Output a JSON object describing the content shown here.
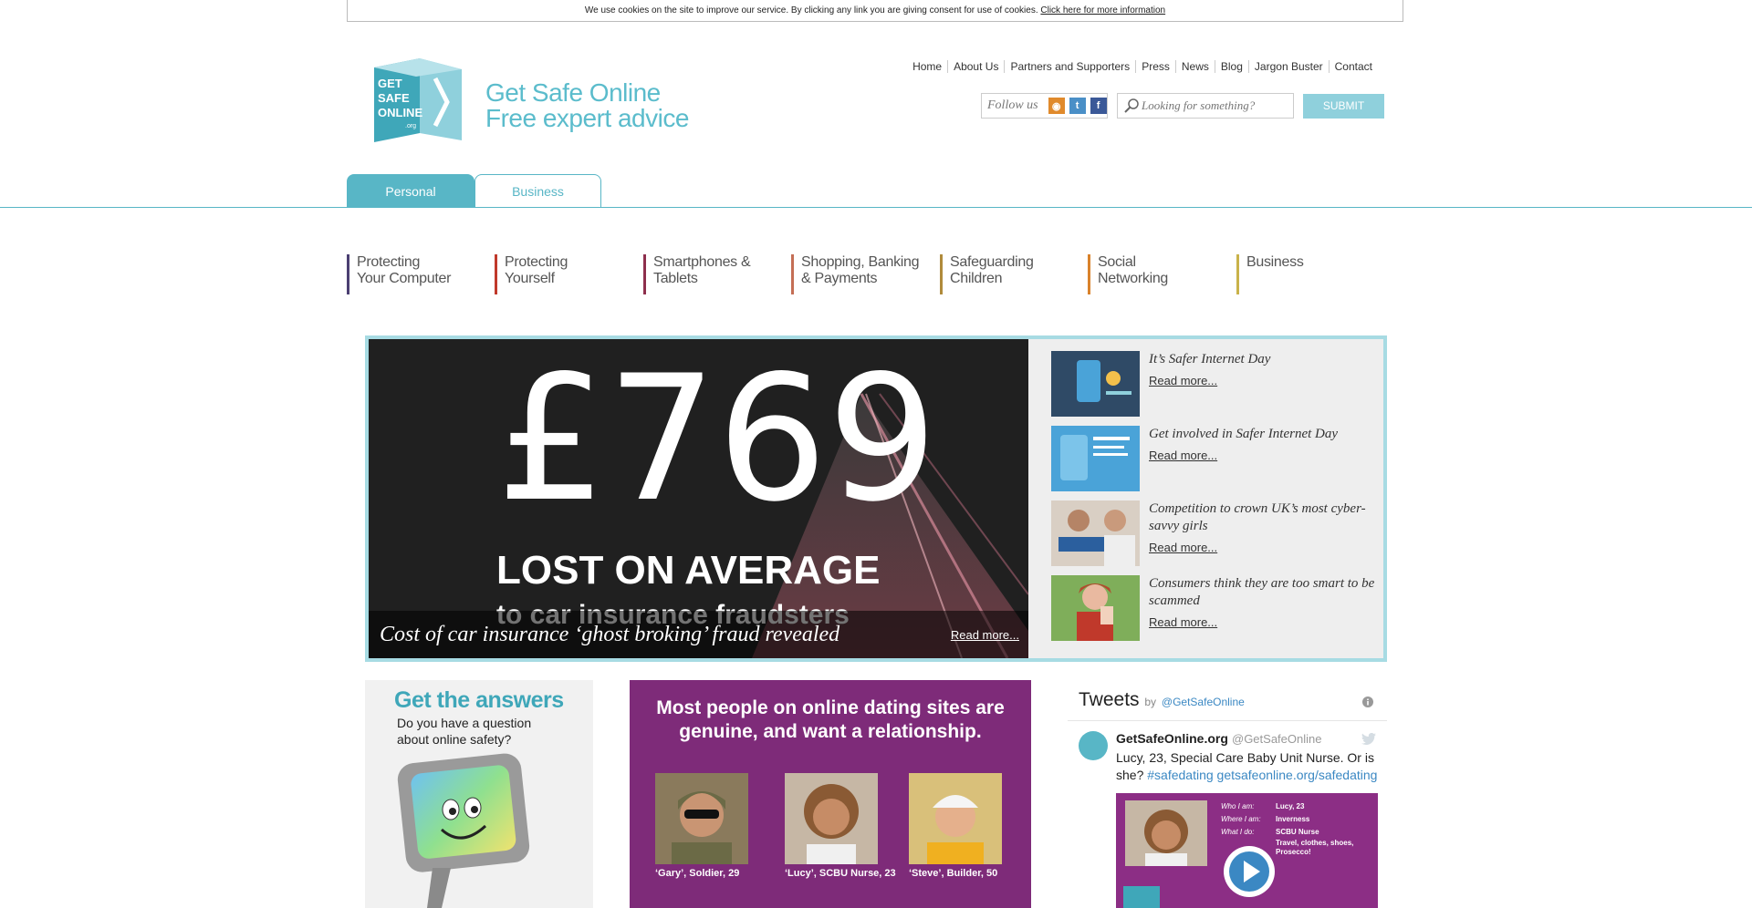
{
  "cookie_bar": {
    "text": "We use cookies on the site to improve our service. By clicking any link you are giving consent for use of cookies.",
    "link": "Click here for more information"
  },
  "brand": {
    "logo_text": [
      "GET",
      "SAFE",
      "ONLINE",
      ".org"
    ],
    "line1": "Get Safe Online",
    "line2": "Free expert advice"
  },
  "top_nav": [
    "Home",
    "About Us",
    "Partners and Supporters",
    "Press",
    "News",
    "Blog",
    "Jargon Buster",
    "Contact"
  ],
  "follow": {
    "label": "Follow us",
    "icons": [
      "rss-icon",
      "twitter-icon",
      "facebook-icon"
    ]
  },
  "search": {
    "placeholder": "Looking for something?",
    "submit": "SUBMIT"
  },
  "tabs": {
    "personal": "Personal",
    "business": "Business"
  },
  "categories": [
    {
      "line1": "Protecting",
      "line2": "Your Computer",
      "color": "#4b3f72"
    },
    {
      "line1": "Protecting",
      "line2": "Yourself",
      "color": "#c0392b"
    },
    {
      "line1": "Smartphones &",
      "line2": "Tablets",
      "color": "#8e2f4d"
    },
    {
      "line1": "Shopping, Banking",
      "line2": "& Payments",
      "color": "#c46e55"
    },
    {
      "line1": "Safeguarding",
      "line2": "Children",
      "color": "#b08b3b"
    },
    {
      "line1": "Social",
      "line2": "Networking",
      "color": "#d9822b"
    },
    {
      "line1": "Business",
      "line2": "",
      "color": "#c9b24a"
    }
  ],
  "hero": {
    "big_text": "£769",
    "headline": "LOST ON AVERAGE",
    "subline": "to car insurance fraudsters",
    "caption": "Cost of car insurance ‘ghost broking’ fraud revealed",
    "read_more": "Read more..."
  },
  "news": [
    {
      "title": "It’s Safer Internet Day",
      "read_more": "Read more..."
    },
    {
      "title": "Get involved in Safer Internet Day",
      "read_more": "Read more..."
    },
    {
      "title": "Competition to crown UK’s most cyber-savvy girls",
      "read_more": "Read more..."
    },
    {
      "title": "Consumers think they are too smart to be scammed",
      "read_more": "Read more..."
    }
  ],
  "answers": {
    "title": "Get the answers",
    "text": "Do you have a question about online safety?"
  },
  "dating": {
    "title_line1": "Most people on online dating sites are",
    "title_line2": "genuine, and want a relationship.",
    "people": [
      "‘Gary’, Soldier, 29",
      "‘Lucy’, SCBU Nurse, 23",
      "‘Steve’, Builder, 50"
    ]
  },
  "tweets": {
    "title": "Tweets",
    "by": "by",
    "account": "@GetSafeOnline",
    "name": "GetSafeOnline.org",
    "handle": "@GetSafeOnline",
    "text": "Lucy, 23, Special Care Baby Unit Nurse. Or is she?",
    "hashtag": "#safedating",
    "link": "getsafeonline.org/safedating",
    "card": {
      "labels": [
        "Who I am:",
        "Where I am:",
        "What I do:"
      ],
      "values": [
        "Lucy, 23",
        "Inverness",
        "SCBU Nurse",
        "Travel, clothes, shoes, Prosecco!"
      ]
    }
  }
}
